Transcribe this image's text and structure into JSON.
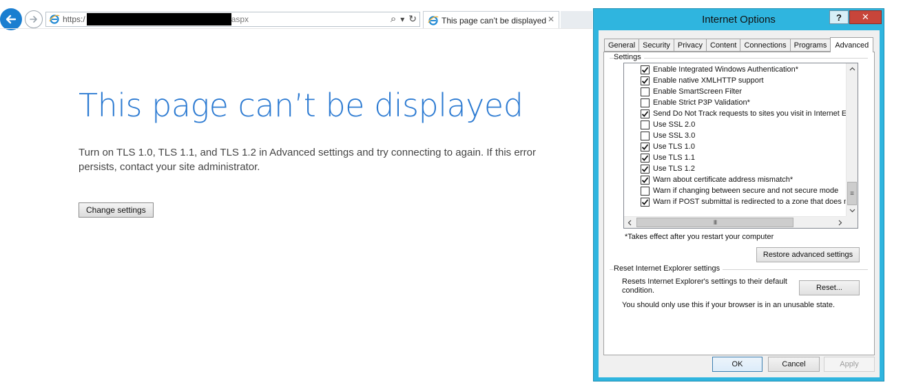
{
  "browser": {
    "url_prefix": "https:/",
    "url_suffix": "aspx",
    "tab_title": "This page can’t be displayed",
    "tab_close": "✕",
    "search_glyph": "⌕",
    "dropdown_glyph": "▾",
    "refresh_glyph": "↻"
  },
  "error_page": {
    "title": "This page can’t be displayed",
    "message": "Turn on TLS 1.0, TLS 1.1, and TLS 1.2 in Advanced settings and try connecting to again.  If this error persists, contact your site administrator.",
    "change_settings_label": "Change settings"
  },
  "dialog": {
    "title": "Internet Options",
    "help_label": "?",
    "close_label": "✕",
    "tabs": [
      {
        "label": "General"
      },
      {
        "label": "Security"
      },
      {
        "label": "Privacy"
      },
      {
        "label": "Content"
      },
      {
        "label": "Connections"
      },
      {
        "label": "Programs"
      },
      {
        "label": "Advanced"
      }
    ],
    "active_tab": "Advanced",
    "settings_label": "Settings",
    "settings_items": [
      {
        "label": "Enable Integrated Windows Authentication*",
        "checked": true
      },
      {
        "label": "Enable native XMLHTTP support",
        "checked": true
      },
      {
        "label": "Enable SmartScreen Filter",
        "checked": false
      },
      {
        "label": "Enable Strict P3P Validation*",
        "checked": false
      },
      {
        "label": "Send Do Not Track requests to sites you visit in Internet E",
        "checked": true
      },
      {
        "label": "Use SSL 2.0",
        "checked": false
      },
      {
        "label": "Use SSL 3.0",
        "checked": false
      },
      {
        "label": "Use TLS 1.0",
        "checked": true
      },
      {
        "label": "Use TLS 1.1",
        "checked": true
      },
      {
        "label": "Use TLS 1.2",
        "checked": true
      },
      {
        "label": "Warn about certificate address mismatch*",
        "checked": true
      },
      {
        "label": "Warn if changing between secure and not secure mode",
        "checked": false
      },
      {
        "label": "Warn if POST submittal is redirected to a zone that does n",
        "checked": true
      }
    ],
    "restart_note": "*Takes effect after you restart your computer",
    "restore_button": "Restore advanced settings",
    "reset_group_label": "Reset Internet Explorer settings",
    "reset_description": "Resets Internet Explorer's settings to their default condition.",
    "reset_button": "Reset...",
    "reset_warning": "You should only use this if your browser is in an unusable state.",
    "ok_button": "OK",
    "cancel_button": "Cancel",
    "apply_button": "Apply",
    "hscroll_grip": "III",
    "vscroll_grip": "≡"
  },
  "colors": {
    "error_title": "#2d7bd2",
    "dialog_frame": "#2fb5df",
    "close_button": "#c7453a"
  }
}
